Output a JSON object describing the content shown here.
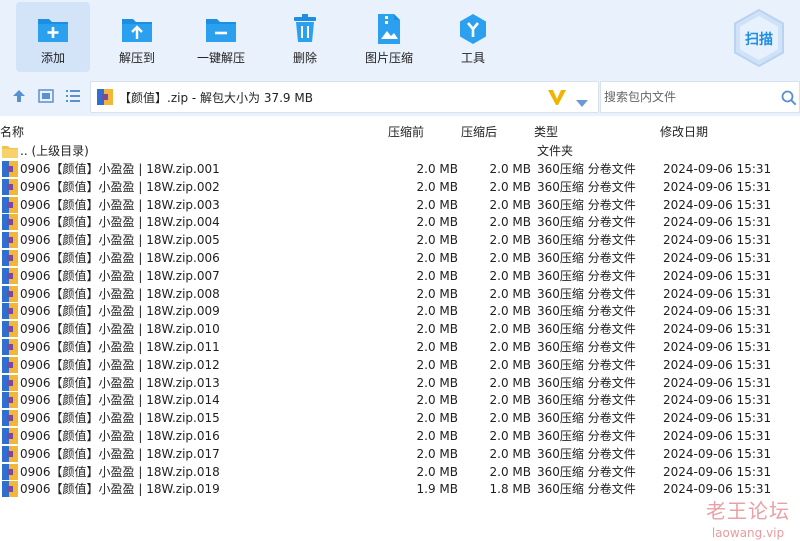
{
  "toolbar": {
    "add": "添加",
    "extract_to": "解压到",
    "one_click": "一键解压",
    "delete": "删除",
    "image_compress": "图片压缩",
    "tools": "工具",
    "scan": "扫描"
  },
  "address": {
    "path": "【颜值】.zip - 解包大小为 37.9 MB"
  },
  "search": {
    "placeholder": "搜索包内文件"
  },
  "columns": {
    "name": "名称",
    "packed": "压缩前",
    "unpacked": "压缩后",
    "type": "类型",
    "modified": "修改日期"
  },
  "parent": {
    "name": ".. (上级目录)",
    "type": "文件夹"
  },
  "files": [
    {
      "name": "0906【颜值】小盈盈 | 18W.zip.001",
      "before": "2.0 MB",
      "after": "2.0 MB",
      "type": "360压缩 分卷文件",
      "date": "2024-09-06 15:31"
    },
    {
      "name": "0906【颜值】小盈盈 | 18W.zip.002",
      "before": "2.0 MB",
      "after": "2.0 MB",
      "type": "360压缩 分卷文件",
      "date": "2024-09-06 15:31"
    },
    {
      "name": "0906【颜值】小盈盈 | 18W.zip.003",
      "before": "2.0 MB",
      "after": "2.0 MB",
      "type": "360压缩 分卷文件",
      "date": "2024-09-06 15:31"
    },
    {
      "name": "0906【颜值】小盈盈 | 18W.zip.004",
      "before": "2.0 MB",
      "after": "2.0 MB",
      "type": "360压缩 分卷文件",
      "date": "2024-09-06 15:31"
    },
    {
      "name": "0906【颜值】小盈盈 | 18W.zip.005",
      "before": "2.0 MB",
      "after": "2.0 MB",
      "type": "360压缩 分卷文件",
      "date": "2024-09-06 15:31"
    },
    {
      "name": "0906【颜值】小盈盈 | 18W.zip.006",
      "before": "2.0 MB",
      "after": "2.0 MB",
      "type": "360压缩 分卷文件",
      "date": "2024-09-06 15:31"
    },
    {
      "name": "0906【颜值】小盈盈 | 18W.zip.007",
      "before": "2.0 MB",
      "after": "2.0 MB",
      "type": "360压缩 分卷文件",
      "date": "2024-09-06 15:31"
    },
    {
      "name": "0906【颜值】小盈盈 | 18W.zip.008",
      "before": "2.0 MB",
      "after": "2.0 MB",
      "type": "360压缩 分卷文件",
      "date": "2024-09-06 15:31"
    },
    {
      "name": "0906【颜值】小盈盈 | 18W.zip.009",
      "before": "2.0 MB",
      "after": "2.0 MB",
      "type": "360压缩 分卷文件",
      "date": "2024-09-06 15:31"
    },
    {
      "name": "0906【颜值】小盈盈 | 18W.zip.010",
      "before": "2.0 MB",
      "after": "2.0 MB",
      "type": "360压缩 分卷文件",
      "date": "2024-09-06 15:31"
    },
    {
      "name": "0906【颜值】小盈盈 | 18W.zip.011",
      "before": "2.0 MB",
      "after": "2.0 MB",
      "type": "360压缩 分卷文件",
      "date": "2024-09-06 15:31"
    },
    {
      "name": "0906【颜值】小盈盈 | 18W.zip.012",
      "before": "2.0 MB",
      "after": "2.0 MB",
      "type": "360压缩 分卷文件",
      "date": "2024-09-06 15:31"
    },
    {
      "name": "0906【颜值】小盈盈 | 18W.zip.013",
      "before": "2.0 MB",
      "after": "2.0 MB",
      "type": "360压缩 分卷文件",
      "date": "2024-09-06 15:31"
    },
    {
      "name": "0906【颜值】小盈盈 | 18W.zip.014",
      "before": "2.0 MB",
      "after": "2.0 MB",
      "type": "360压缩 分卷文件",
      "date": "2024-09-06 15:31"
    },
    {
      "name": "0906【颜值】小盈盈 | 18W.zip.015",
      "before": "2.0 MB",
      "after": "2.0 MB",
      "type": "360压缩 分卷文件",
      "date": "2024-09-06 15:31"
    },
    {
      "name": "0906【颜值】小盈盈 | 18W.zip.016",
      "before": "2.0 MB",
      "after": "2.0 MB",
      "type": "360压缩 分卷文件",
      "date": "2024-09-06 15:31"
    },
    {
      "name": "0906【颜值】小盈盈 | 18W.zip.017",
      "before": "2.0 MB",
      "after": "2.0 MB",
      "type": "360压缩 分卷文件",
      "date": "2024-09-06 15:31"
    },
    {
      "name": "0906【颜值】小盈盈 | 18W.zip.018",
      "before": "2.0 MB",
      "after": "2.0 MB",
      "type": "360压缩 分卷文件",
      "date": "2024-09-06 15:31"
    },
    {
      "name": "0906【颜值】小盈盈 | 18W.zip.019",
      "before": "1.9 MB",
      "after": "1.8 MB",
      "type": "360压缩 分卷文件",
      "date": "2024-09-06 15:31"
    }
  ],
  "watermark": {
    "line1": "老王论坛",
    "line2": "laowang.vip"
  },
  "colors": {
    "accent": "#1e8fe0",
    "toolbar_bg": "#e9f1fc",
    "folder": "#f2c34e"
  }
}
